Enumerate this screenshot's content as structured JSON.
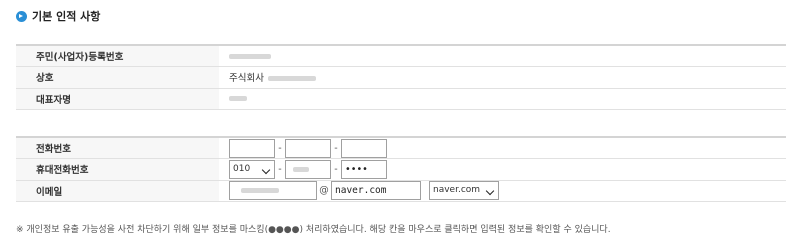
{
  "section": {
    "title": "기본 인적 사항"
  },
  "basic_rows": [
    {
      "label": "주민(사업자)등록번호"
    },
    {
      "label": "상호",
      "value_prefix": "주식회사"
    },
    {
      "label": "대표자명"
    }
  ],
  "contact": {
    "phone": {
      "label": "전화번호",
      "part1": "",
      "part2": "",
      "part3": "",
      "separator": "-"
    },
    "mobile": {
      "label": "휴대전화번호",
      "carrier_prefix": "010",
      "part3": "••••",
      "separator": "-"
    },
    "email": {
      "label": "이메일",
      "at": "@",
      "domain": "naver.com",
      "domain_select": "naver.com"
    }
  },
  "notice": "※ 개인정보 유출 가능성을 사전 차단하기 위해 일부 정보를 마스킹(●●●●) 처리하였습니다. 해당 칸을 마우스로 클릭하면 입력된 정보를 확인할 수 있습니다.",
  "colors": {
    "accent": "#2a8fd6",
    "label_bg": "#f7f7f7",
    "border": "#e1e1e1"
  }
}
